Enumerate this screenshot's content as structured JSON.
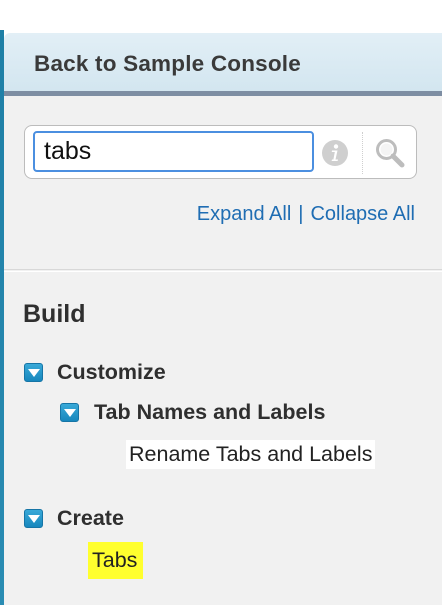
{
  "header": {
    "back_label": "Back to Sample Console"
  },
  "search": {
    "value": "tabs",
    "info_icon": "info-icon",
    "search_icon": "magnifier-icon"
  },
  "tree_controls": {
    "expand_all": "Expand All",
    "separator": "|",
    "collapse_all": "Collapse All"
  },
  "section": {
    "heading": "Build"
  },
  "tree": {
    "customize": {
      "label": "Customize",
      "expanded": true,
      "child": {
        "label": "Tab Names and Labels",
        "expanded": true,
        "leaf": "Rename Tabs and Labels"
      }
    },
    "create": {
      "label": "Create",
      "expanded": true,
      "leaf": "Tabs"
    }
  },
  "colors": {
    "link": "#1f6db3",
    "toggle": "#1787bd",
    "highlight": "#ffff2e",
    "focus_border": "#4b8fe0"
  }
}
